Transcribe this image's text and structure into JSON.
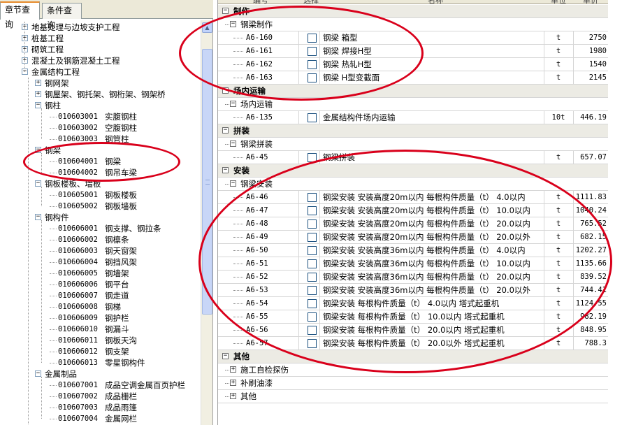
{
  "tabs": [
    {
      "label": "章节查询",
      "active": true
    },
    {
      "label": "条件查询",
      "active": false
    }
  ],
  "tree": {
    "top_items": [
      {
        "label": "地基处理与边坡支护工程",
        "expanded": false
      },
      {
        "label": "桩基工程",
        "expanded": false
      },
      {
        "label": "砌筑工程",
        "expanded": false
      },
      {
        "label": "混凝土及钢筋混凝土工程",
        "expanded": false
      },
      {
        "label": "金属结构工程",
        "expanded": true
      }
    ],
    "metal_children": [
      {
        "label": "钢网架",
        "expanded": false
      },
      {
        "label": "钢屋架、钢托架、钢桁架、钢架桥",
        "expanded": false
      },
      {
        "label": "钢柱",
        "expanded": true,
        "items": [
          {
            "code": "010603001",
            "name": "实腹钢柱"
          },
          {
            "code": "010603002",
            "name": "空腹钢柱"
          },
          {
            "code": "010603003",
            "name": "钢管柱"
          }
        ]
      },
      {
        "label": "钢梁",
        "expanded": true,
        "items": [
          {
            "code": "010604001",
            "name": "钢梁"
          },
          {
            "code": "010604002",
            "name": "钢吊车梁"
          }
        ]
      },
      {
        "label": "钢板楼板、墙板",
        "expanded": true,
        "items": [
          {
            "code": "010605001",
            "name": "钢板楼板"
          },
          {
            "code": "010605002",
            "name": "钢板墙板"
          }
        ]
      },
      {
        "label": "钢构件",
        "expanded": true,
        "items": [
          {
            "code": "010606001",
            "name": "钢支撑、钢拉条"
          },
          {
            "code": "010606002",
            "name": "钢檩条"
          },
          {
            "code": "010606003",
            "name": "钢天窗架"
          },
          {
            "code": "010606004",
            "name": "钢挡风架"
          },
          {
            "code": "010606005",
            "name": "钢墙架"
          },
          {
            "code": "010606006",
            "name": "钢平台"
          },
          {
            "code": "010606007",
            "name": "钢走道"
          },
          {
            "code": "010606008",
            "name": "钢梯"
          },
          {
            "code": "010606009",
            "name": "钢护栏"
          },
          {
            "code": "010606010",
            "name": "钢漏斗"
          },
          {
            "code": "010606011",
            "name": "钢板天沟"
          },
          {
            "code": "010606012",
            "name": "钢支架"
          },
          {
            "code": "010606013",
            "name": "零星钢构件"
          }
        ]
      },
      {
        "label": "金属制品",
        "expanded": true,
        "items": [
          {
            "code": "010607001",
            "name": "成品空调金属百页护栏"
          },
          {
            "code": "010607002",
            "name": "成品栅栏"
          },
          {
            "code": "010607003",
            "name": "成品雨篷"
          },
          {
            "code": "010607004",
            "name": "金属网栏"
          }
        ]
      }
    ]
  },
  "grid": {
    "header": [
      "编号",
      "选择",
      "名称",
      "单位",
      "单价"
    ],
    "sections": [
      {
        "title": "制作",
        "groups": [
          {
            "title": "钢梁制作",
            "items": [
              {
                "code": "A6-160",
                "name": "钢梁 箱型",
                "unit": "t",
                "price": "2750"
              },
              {
                "code": "A6-161",
                "name": "钢梁 焊接H型",
                "unit": "t",
                "price": "1980"
              },
              {
                "code": "A6-162",
                "name": "钢梁 热轧H型",
                "unit": "t",
                "price": "1540"
              },
              {
                "code": "A6-163",
                "name": "钢梁 H型变截面",
                "unit": "t",
                "price": "2145"
              }
            ]
          }
        ]
      },
      {
        "title": "场内运输",
        "groups": [
          {
            "title": "场内运输",
            "items": [
              {
                "code": "A6-135",
                "name": "金属结构件场内运输",
                "unit": "10t",
                "price": "446.19"
              }
            ]
          }
        ]
      },
      {
        "title": "拼装",
        "groups": [
          {
            "title": "钢梁拼装",
            "items": [
              {
                "code": "A6-45",
                "name": "钢梁拼装",
                "unit": "t",
                "price": "657.07"
              }
            ]
          }
        ]
      },
      {
        "title": "安装",
        "groups": [
          {
            "title": "钢梁安装",
            "items": [
              {
                "code": "A6-46",
                "name": "钢梁安装 安装高度20m以内 每根构件质量（t） 4.0以内",
                "unit": "t",
                "price": "1111.83"
              },
              {
                "code": "A6-47",
                "name": "钢梁安装 安装高度20m以内 每根构件质量（t） 10.0以内",
                "unit": "t",
                "price": "1040.24"
              },
              {
                "code": "A6-48",
                "name": "钢梁安装 安装高度20m以内 每根构件质量（t） 20.0以内",
                "unit": "t",
                "price": "765.52"
              },
              {
                "code": "A6-49",
                "name": "钢梁安装 安装高度20m以内 每根构件质量（t） 20.0以外",
                "unit": "t",
                "price": "682.15"
              },
              {
                "code": "A6-50",
                "name": "钢梁安装 安装高度36m以内 每根构件质量（t） 4.0以内",
                "unit": "t",
                "price": "1202.27"
              },
              {
                "code": "A6-51",
                "name": "钢梁安装 安装高度36m以内 每根构件质量（t） 10.0以内",
                "unit": "t",
                "price": "1135.66"
              },
              {
                "code": "A6-52",
                "name": "钢梁安装 安装高度36m以内 每根构件质量（t） 20.0以内",
                "unit": "t",
                "price": "839.52"
              },
              {
                "code": "A6-53",
                "name": "钢梁安装 安装高度36m以内 每根构件质量（t） 20.0以外",
                "unit": "t",
                "price": "744.41"
              },
              {
                "code": "A6-54",
                "name": "钢梁安装 每根构件质量（t） 4.0以内 塔式起重机",
                "unit": "t",
                "price": "1124.55"
              },
              {
                "code": "A6-55",
                "name": "钢梁安装 每根构件质量（t） 10.0以内 塔式起重机",
                "unit": "t",
                "price": "982.19"
              },
              {
                "code": "A6-56",
                "name": "钢梁安装 每根构件质量（t） 20.0以内 塔式起重机",
                "unit": "t",
                "price": "848.95"
              },
              {
                "code": "A6-57",
                "name": "钢梁安装 每根构件质量（t） 20.0以外 塔式起重机",
                "unit": "t",
                "price": "788.3"
              }
            ]
          }
        ]
      },
      {
        "title": "其他",
        "groups": [
          {
            "title": "施工自检探伤",
            "collapsed": true,
            "items": []
          },
          {
            "title": "补刷油漆",
            "collapsed": true,
            "items": []
          },
          {
            "title": "其他",
            "collapsed": true,
            "items": []
          }
        ]
      }
    ]
  },
  "colors": {
    "annotation": "#d9001b",
    "category_bg": "#ecebe4",
    "tab_accent": "#e68b2c"
  }
}
